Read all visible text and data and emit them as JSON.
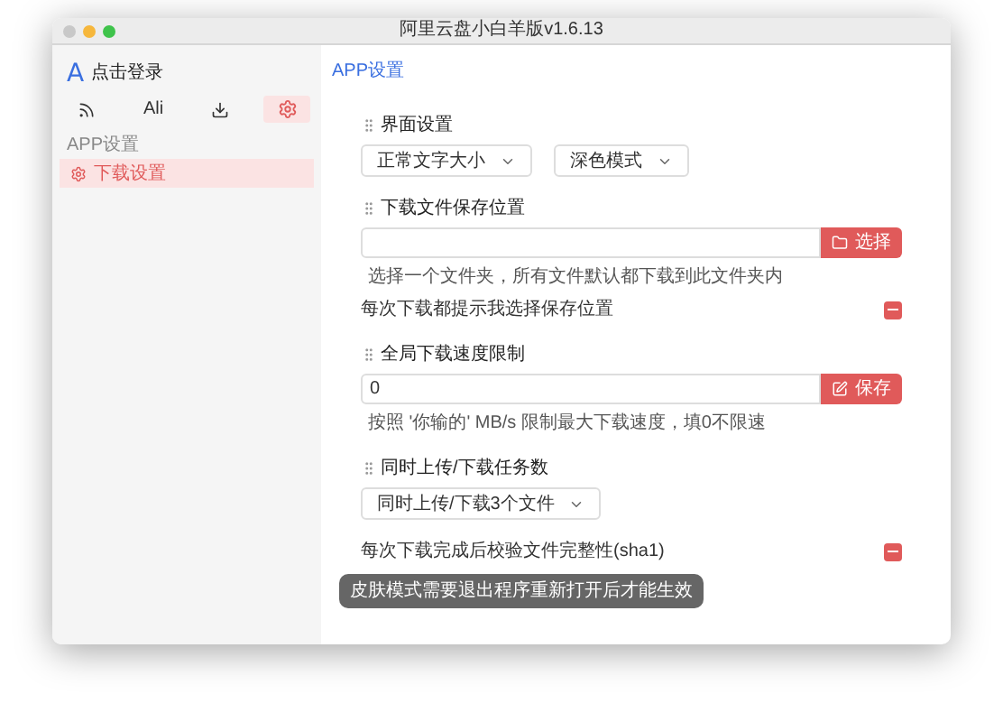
{
  "window": {
    "title": "阿里云盘小白羊版v1.6.13"
  },
  "sidebar": {
    "logo": "A",
    "login": "点击登录",
    "tabs": [
      {
        "kind": "rss",
        "selected": false
      },
      {
        "kind": "text",
        "label": "Ali",
        "selected": false
      },
      {
        "kind": "download",
        "selected": false
      },
      {
        "kind": "settings",
        "selected": true
      }
    ],
    "group": "APP设置",
    "items": [
      {
        "label": "下载设置",
        "selected": true
      }
    ]
  },
  "breadcrumb": "APP设置",
  "sections": [
    {
      "kind": "selects",
      "title": "界面设置",
      "selects": [
        "正常文字大小",
        "深色模式"
      ]
    },
    {
      "kind": "folder",
      "title": "下载文件保存位置",
      "button": "选择",
      "hint": "选择一个文件夹，所有文件默认都下载到此文件夹内",
      "check": {
        "label": "每次下载都提示我选择保存位置",
        "checked": true
      }
    },
    {
      "kind": "edit",
      "title": "全局下载速度限制",
      "value": "0",
      "button": "保存",
      "hint": "按照 '你输的' MB/s 限制最大下载速度，填0不限速"
    },
    {
      "kind": "selects",
      "title": "同时上传/下载任务数",
      "selects": [
        "同时上传/下载3个文件"
      ]
    },
    {
      "kind": "check",
      "check": {
        "label": "每次下载完成后校验文件完整性(sha1)",
        "checked": true
      }
    }
  ],
  "toast": "皮肤模式需要退出程序重新打开后才能生效"
}
